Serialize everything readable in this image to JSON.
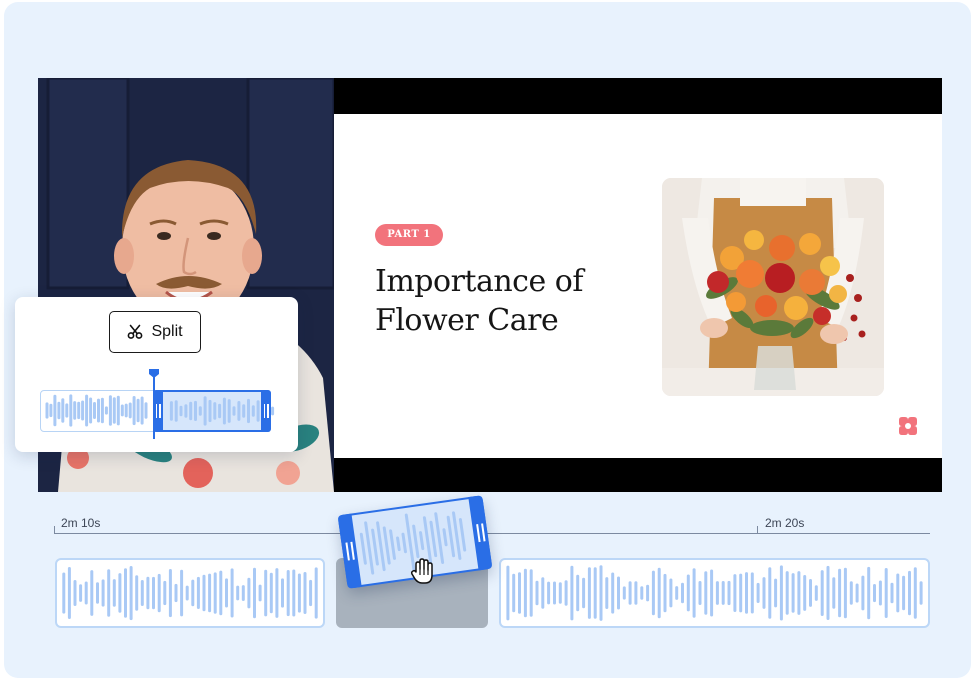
{
  "slide": {
    "part_label": "PART 1",
    "title_line1": "Importance of",
    "title_line2": "Flower Care"
  },
  "split_tool": {
    "button_label": "Split",
    "button_icon": "scissors-icon"
  },
  "timeline": {
    "marker_left": "2m 10s",
    "marker_right": "2m 20s"
  },
  "colors": {
    "accent_blue": "#2a6ee6",
    "waveform_light": "#a9c9f5",
    "pill_coral": "#f2737c",
    "background": "#e8f2fd"
  },
  "icons": [
    "scissors-icon",
    "grab-hand-cursor-icon",
    "brand-logo-icon"
  ]
}
